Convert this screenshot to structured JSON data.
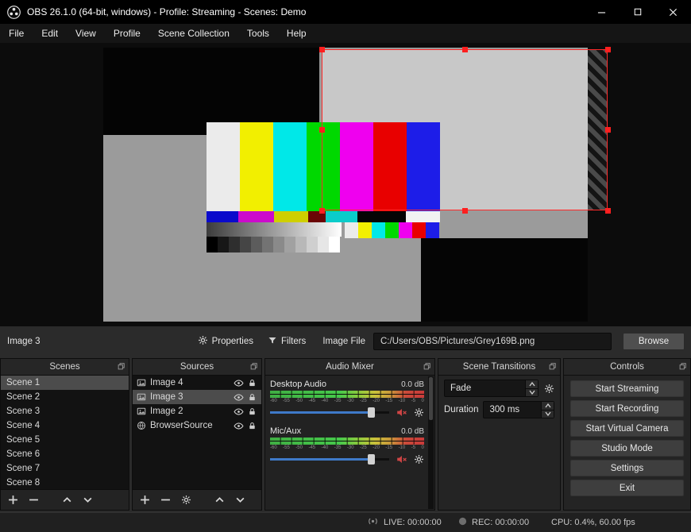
{
  "window": {
    "title": "OBS 26.1.0 (64-bit, windows) - Profile: Streaming - Scenes: Demo"
  },
  "menu": [
    "File",
    "Edit",
    "View",
    "Profile",
    "Scene Collection",
    "Tools",
    "Help"
  ],
  "source_toolbar": {
    "selected_source": "Image 3",
    "properties": "Properties",
    "filters": "Filters",
    "image_file_label": "Image File",
    "image_file_path": "C:/Users/OBS/Pictures/Grey169B.png",
    "browse": "Browse"
  },
  "scenes": {
    "title": "Scenes",
    "items": [
      "Scene 1",
      "Scene 2",
      "Scene 3",
      "Scene 4",
      "Scene 5",
      "Scene 6",
      "Scene 7",
      "Scene 8"
    ],
    "selected_index": 0
  },
  "sources": {
    "title": "Sources",
    "items": [
      {
        "name": "Image 4",
        "icon": "image",
        "selected": false
      },
      {
        "name": "Image 3",
        "icon": "image",
        "selected": true
      },
      {
        "name": "Image 2",
        "icon": "image",
        "selected": false
      },
      {
        "name": "BrowserSource",
        "icon": "globe",
        "selected": false
      }
    ]
  },
  "audio_mixer": {
    "title": "Audio Mixer",
    "channels": [
      {
        "name": "Desktop Audio",
        "db": "0.0 dB",
        "muted": true,
        "volume_pct": 85
      },
      {
        "name": "Mic/Aux",
        "db": "0.0 dB",
        "muted": true,
        "volume_pct": 85
      }
    ],
    "scale": [
      "-60",
      "-55",
      "-50",
      "-45",
      "-40",
      "-35",
      "-30",
      "-25",
      "-20",
      "-15",
      "-10",
      "-5",
      "0"
    ]
  },
  "transitions": {
    "title": "Scene Transitions",
    "transition": "Fade",
    "duration_label": "Duration",
    "duration": "300 ms"
  },
  "controls": {
    "title": "Controls",
    "buttons": [
      "Start Streaming",
      "Start Recording",
      "Start Virtual Camera",
      "Studio Mode",
      "Settings",
      "Exit"
    ]
  },
  "status_bar": {
    "live": "LIVE: 00:00:00",
    "rec": "REC: 00:00:00",
    "cpu": "CPU: 0.4%, 60.00 fps"
  },
  "accent_colors": {
    "selection_red": "#ff2a2a",
    "slider_blue": "#3f7ac9",
    "mute_red": "#cf4545",
    "list_selection": "#4c4c4c"
  }
}
